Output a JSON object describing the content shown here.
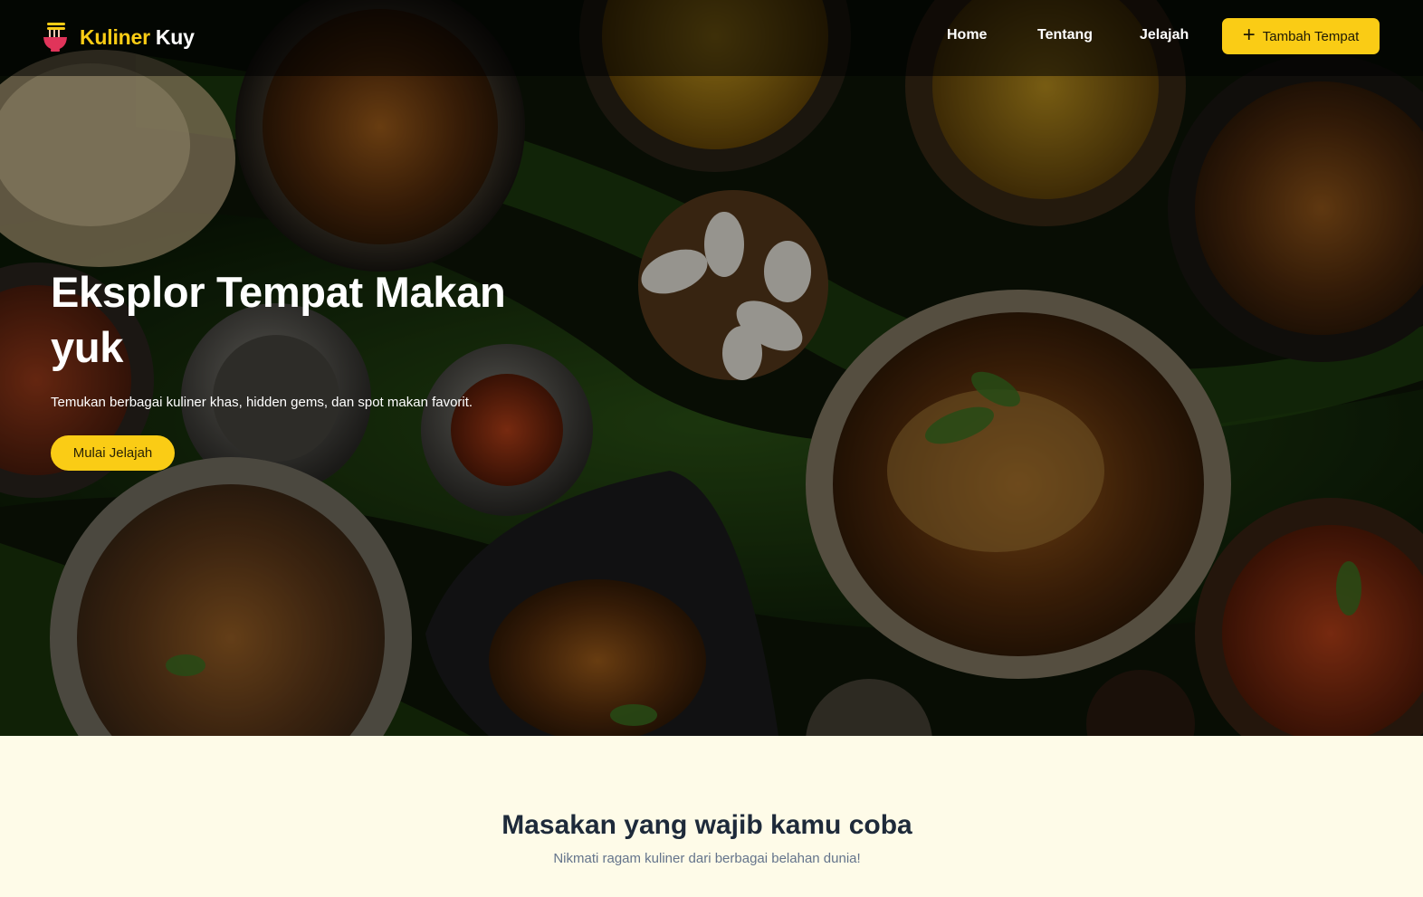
{
  "navbar": {
    "brand_first": "Kuliner",
    "brand_second": "Kuy",
    "brand_icon": "noodle-bowl-icon",
    "links": [
      "Home",
      "Tentang",
      "Jelajah"
    ],
    "add_button_label": "Tambah Tempat",
    "add_button_icon": "plus-icon"
  },
  "hero": {
    "title": "Eksplor Tempat Makan yuk",
    "subtitle": "Temukan berbagai kuliner khas, hidden gems, dan spot makan favorit.",
    "cta_label": "Mulai Jelajah"
  },
  "section": {
    "title": "Masakan yang wajib kamu coba",
    "subtitle": "Nikmati ragam kuliner dari berbagai belahan dunia!"
  },
  "colors": {
    "accent": "#facc15",
    "section_bg": "#fefbe8",
    "heading": "#1e2a3a",
    "muted": "#64748b"
  }
}
